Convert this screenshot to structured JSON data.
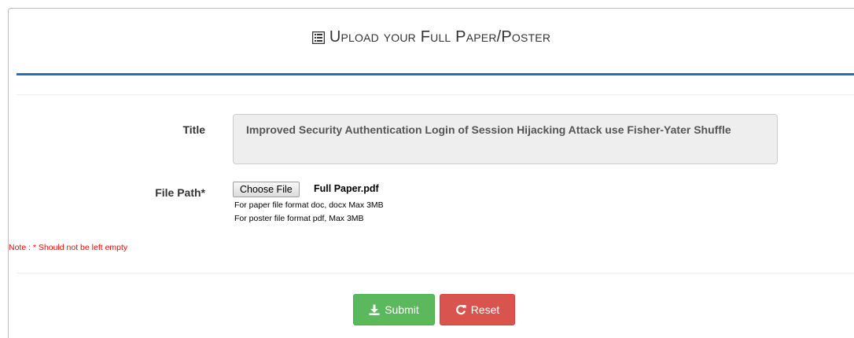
{
  "form": {
    "heading": "Upload your Full Paper/Poster",
    "heading_icon": "list-alt-icon",
    "title_label": "Title",
    "title_value": "Improved Security Authentication Login of Session Hijacking Attack use Fisher-Yater Shuffle",
    "file_label": "File Path*",
    "choose_file_label": "Choose File",
    "file_name": "Full Paper.pdf",
    "hint_paper": "For paper file format doc, docx Max 3MB",
    "hint_poster": "For poster file format pdf, Max 3MB",
    "note": "Note : * Should not be left empty",
    "submit_label": "Submit",
    "reset_label": "Reset"
  },
  "colors": {
    "accent_rule": "#1e73be",
    "submit": "#5cb85c",
    "reset": "#d9534f",
    "note": "#ff0000"
  }
}
